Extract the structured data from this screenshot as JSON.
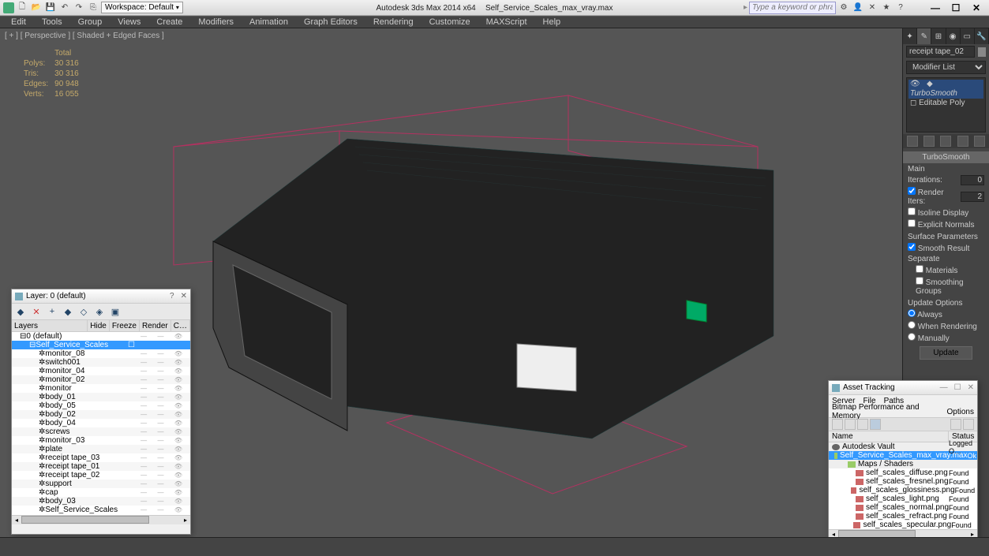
{
  "app": {
    "title_left": "Autodesk 3ds Max  2014 x64",
    "title_right": "Self_Service_Scales_max_vray.max",
    "workspace_label": "Workspace: Default",
    "search_placeholder": "Type a keyword or phrase"
  },
  "menu": [
    "Edit",
    "Tools",
    "Group",
    "Views",
    "Create",
    "Modifiers",
    "Animation",
    "Graph Editors",
    "Rendering",
    "Customize",
    "MAXScript",
    "Help"
  ],
  "viewport": {
    "label": "[ + ] [ Perspective ] [ Shaded + Edged Faces ]",
    "stats": {
      "total_label": "Total",
      "polys_label": "Polys:",
      "polys": "30 316",
      "tris_label": "Tris:",
      "tris": "30 316",
      "edges_label": "Edges:",
      "edges": "90 948",
      "verts_label": "Verts:",
      "verts": "16 055"
    }
  },
  "cmd": {
    "selected": "receipt tape_02",
    "modlist_label": "Modifier List",
    "stack": {
      "top": "TurboSmooth",
      "base": "Editable Poly"
    },
    "rollup": "TurboSmooth",
    "main_label": "Main",
    "iter_label": "Iterations:",
    "iter_val": "0",
    "render_iter_label": "Render Iters:",
    "render_iter_val": "2",
    "isoline": "Isoline Display",
    "explicit": "Explicit Normals",
    "surf_params": "Surface Parameters",
    "smooth_result": "Smooth Result",
    "separate": "Separate",
    "materials": "Materials",
    "smgroups": "Smoothing Groups",
    "update_opts": "Update Options",
    "always": "Always",
    "render": "When Rendering",
    "manually": "Manually",
    "update_btn": "Update"
  },
  "layers": {
    "title": "Layer: 0 (default)",
    "cols": {
      "layers": "Layers",
      "hide": "Hide",
      "freeze": "Freeze",
      "render": "Render",
      "c": "C…"
    },
    "items": [
      {
        "name": "0 (default)",
        "lvl": 0,
        "sel": false,
        "type": "layer"
      },
      {
        "name": "Self_Service_Scales",
        "lvl": 1,
        "sel": true,
        "type": "layer"
      },
      {
        "name": "monitor_08",
        "lvl": 2,
        "sel": false
      },
      {
        "name": "switch001",
        "lvl": 2,
        "sel": false
      },
      {
        "name": "monitor_04",
        "lvl": 2,
        "sel": false
      },
      {
        "name": "monitor_02",
        "lvl": 2,
        "sel": false
      },
      {
        "name": "monitor",
        "lvl": 2,
        "sel": false
      },
      {
        "name": "body_01",
        "lvl": 2,
        "sel": false
      },
      {
        "name": "body_05",
        "lvl": 2,
        "sel": false
      },
      {
        "name": "body_02",
        "lvl": 2,
        "sel": false
      },
      {
        "name": "body_04",
        "lvl": 2,
        "sel": false
      },
      {
        "name": "screws",
        "lvl": 2,
        "sel": false
      },
      {
        "name": "monitor_03",
        "lvl": 2,
        "sel": false
      },
      {
        "name": "plate",
        "lvl": 2,
        "sel": false
      },
      {
        "name": "receipt tape_03",
        "lvl": 2,
        "sel": false
      },
      {
        "name": "receipt tape_01",
        "lvl": 2,
        "sel": false
      },
      {
        "name": "receipt tape_02",
        "lvl": 2,
        "sel": false
      },
      {
        "name": "support",
        "lvl": 2,
        "sel": false
      },
      {
        "name": "cap",
        "lvl": 2,
        "sel": false
      },
      {
        "name": "body_03",
        "lvl": 2,
        "sel": false
      },
      {
        "name": "Self_Service_Scales",
        "lvl": 2,
        "sel": false
      }
    ]
  },
  "asset": {
    "title": "Asset Tracking",
    "menu1": [
      "Server",
      "File",
      "Paths"
    ],
    "menu2": [
      "Bitmap Performance and Memory",
      "Options"
    ],
    "cols": {
      "name": "Name",
      "status": "Status"
    },
    "rows": [
      {
        "name": "Autodesk Vault",
        "status": "Logged O…",
        "ico": "vault",
        "lvl": 0,
        "grp": true
      },
      {
        "name": "Self_Service_Scales_max_vray.max",
        "status": "Ok",
        "ico": "scene",
        "lvl": 1,
        "sel": true
      },
      {
        "name": "Maps / Shaders",
        "status": "",
        "ico": "scene",
        "lvl": 2,
        "grp": true
      },
      {
        "name": "self_scales_diffuse.png",
        "status": "Found",
        "ico": "map",
        "lvl": 3
      },
      {
        "name": "self_scales_fresnel.png",
        "status": "Found",
        "ico": "map",
        "lvl": 3
      },
      {
        "name": "self_scales_glossiness.png",
        "status": "Found",
        "ico": "map",
        "lvl": 3
      },
      {
        "name": "self_scales_light.png",
        "status": "Found",
        "ico": "map",
        "lvl": 3
      },
      {
        "name": "self_scales_normal.png",
        "status": "Found",
        "ico": "map",
        "lvl": 3
      },
      {
        "name": "self_scales_refract.png",
        "status": "Found",
        "ico": "map",
        "lvl": 3
      },
      {
        "name": "self_scales_specular.png",
        "status": "Found",
        "ico": "map",
        "lvl": 3
      }
    ]
  }
}
